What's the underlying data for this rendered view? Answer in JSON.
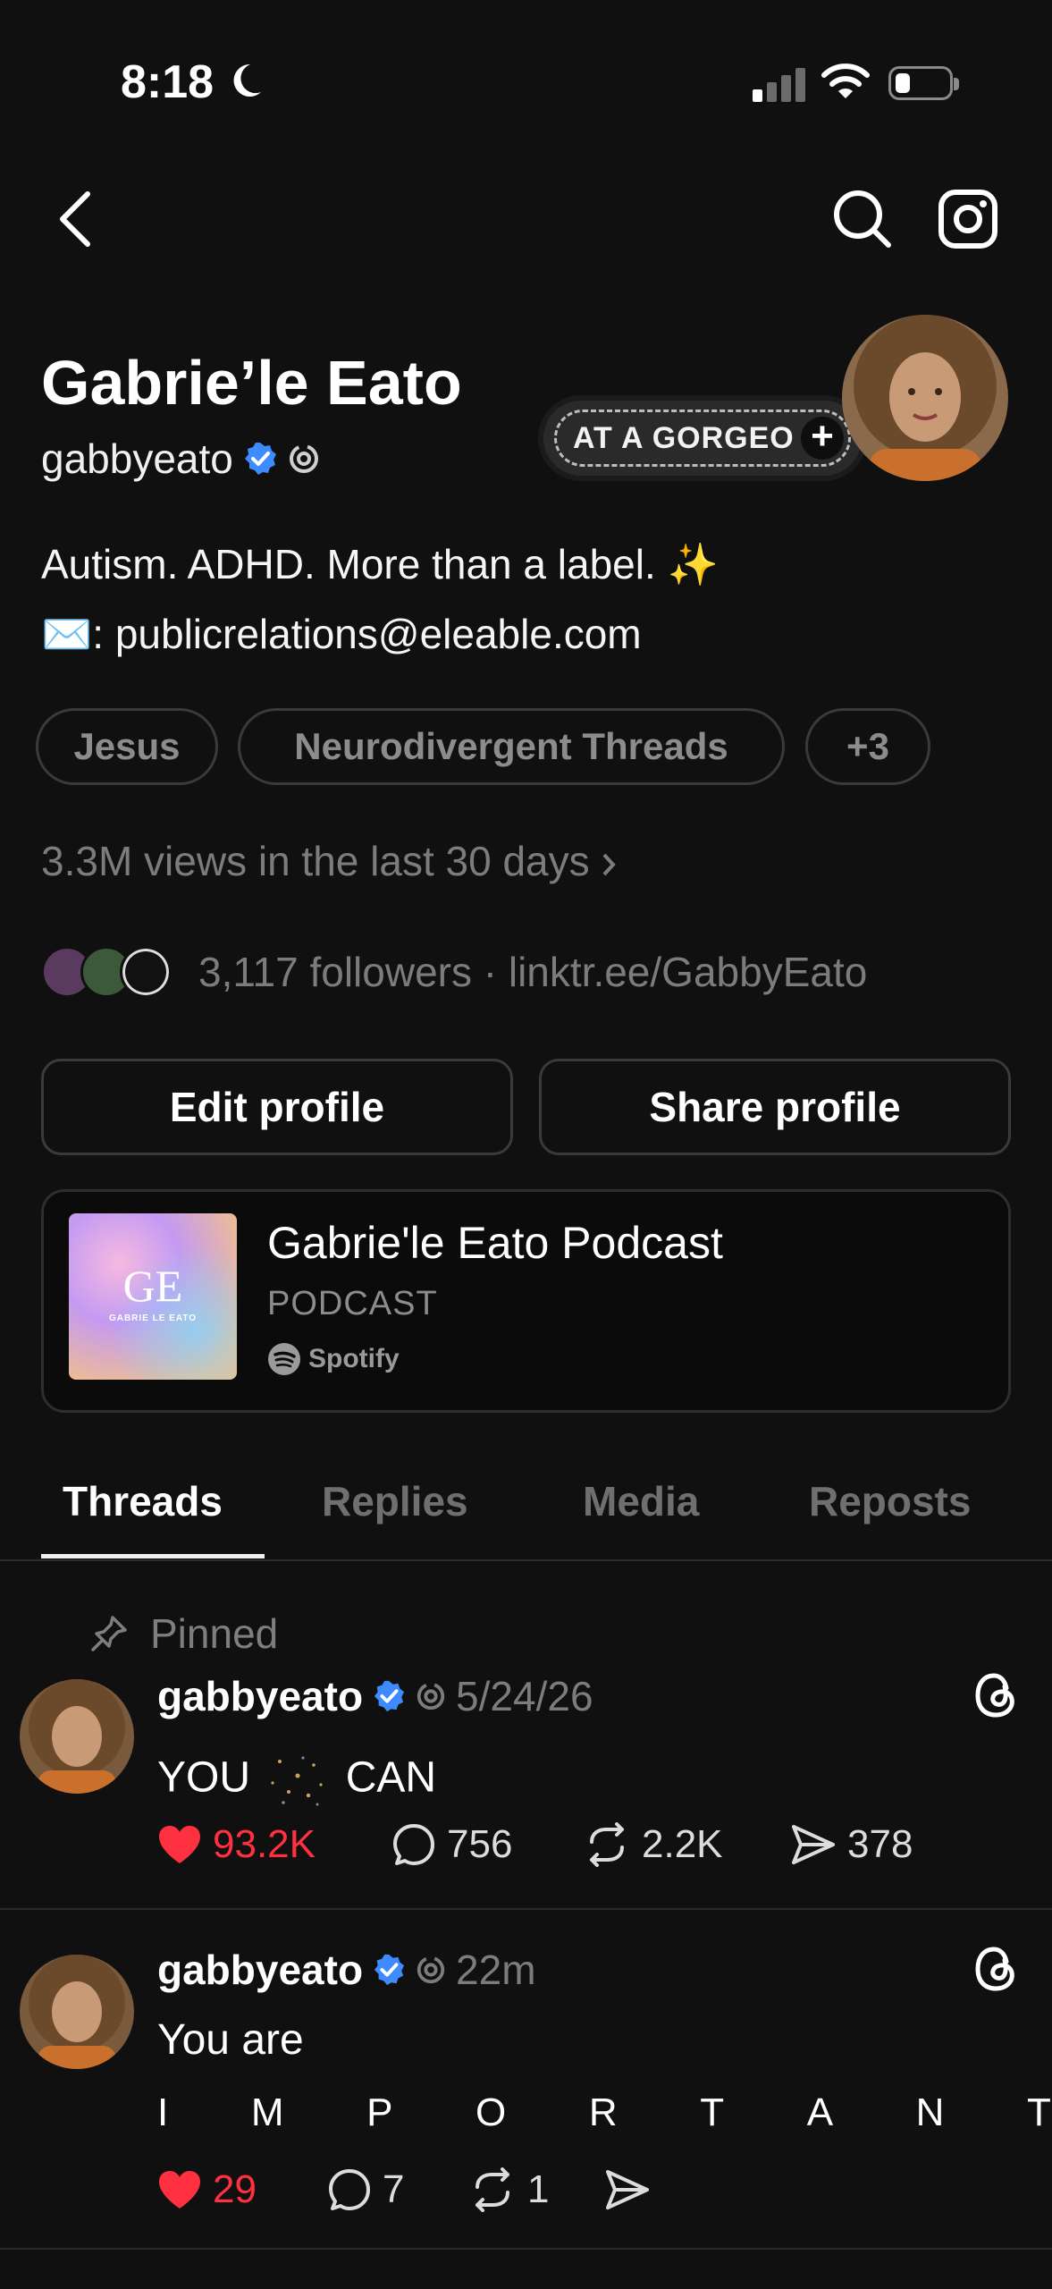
{
  "status_bar": {
    "time": "8:18"
  },
  "profile": {
    "name": "Gabrie’le Eato",
    "handle": "gabbyeato",
    "music_chip": "AT A GORGEO",
    "bio_line1": "Autism. ADHD. More than a label. ✨",
    "bio_line2": "✉️: publicrelations@eleable.com",
    "tags": [
      "Jesus",
      "Neurodivergent Threads",
      "+3"
    ],
    "views": "3.3M views in the last 30 days",
    "followers": "3,117 followers · linktr.ee/GabbyEato",
    "edit_label": "Edit profile",
    "share_label": "Share profile"
  },
  "podcast": {
    "title": "Gabrie'le Eato Podcast",
    "subtitle": "PODCAST",
    "source": "Spotify",
    "art_text": "GE",
    "art_caption": "GABRIE LE EATO"
  },
  "tabs": [
    "Threads",
    "Replies",
    "Media",
    "Reposts"
  ],
  "posts": [
    {
      "pinned_label": "Pinned",
      "user": "gabbyeato",
      "time": "5/24/26",
      "text_a": "YOU",
      "text_b": "CAN",
      "likes": "93.2K",
      "replies": "756",
      "reposts": "2.2K",
      "shares": "378"
    },
    {
      "user": "gabbyeato",
      "time": "22m",
      "text": "You are",
      "letters": [
        "I",
        "M",
        "P",
        "O",
        "R",
        "T",
        "A",
        "N",
        "T"
      ],
      "likes": "29",
      "replies": "7",
      "reposts": "1"
    }
  ],
  "colors": {
    "background": "#101010",
    "like_red": "#ff3040",
    "verified_blue": "#3d8bff",
    "muted": "#7c7c7c"
  }
}
